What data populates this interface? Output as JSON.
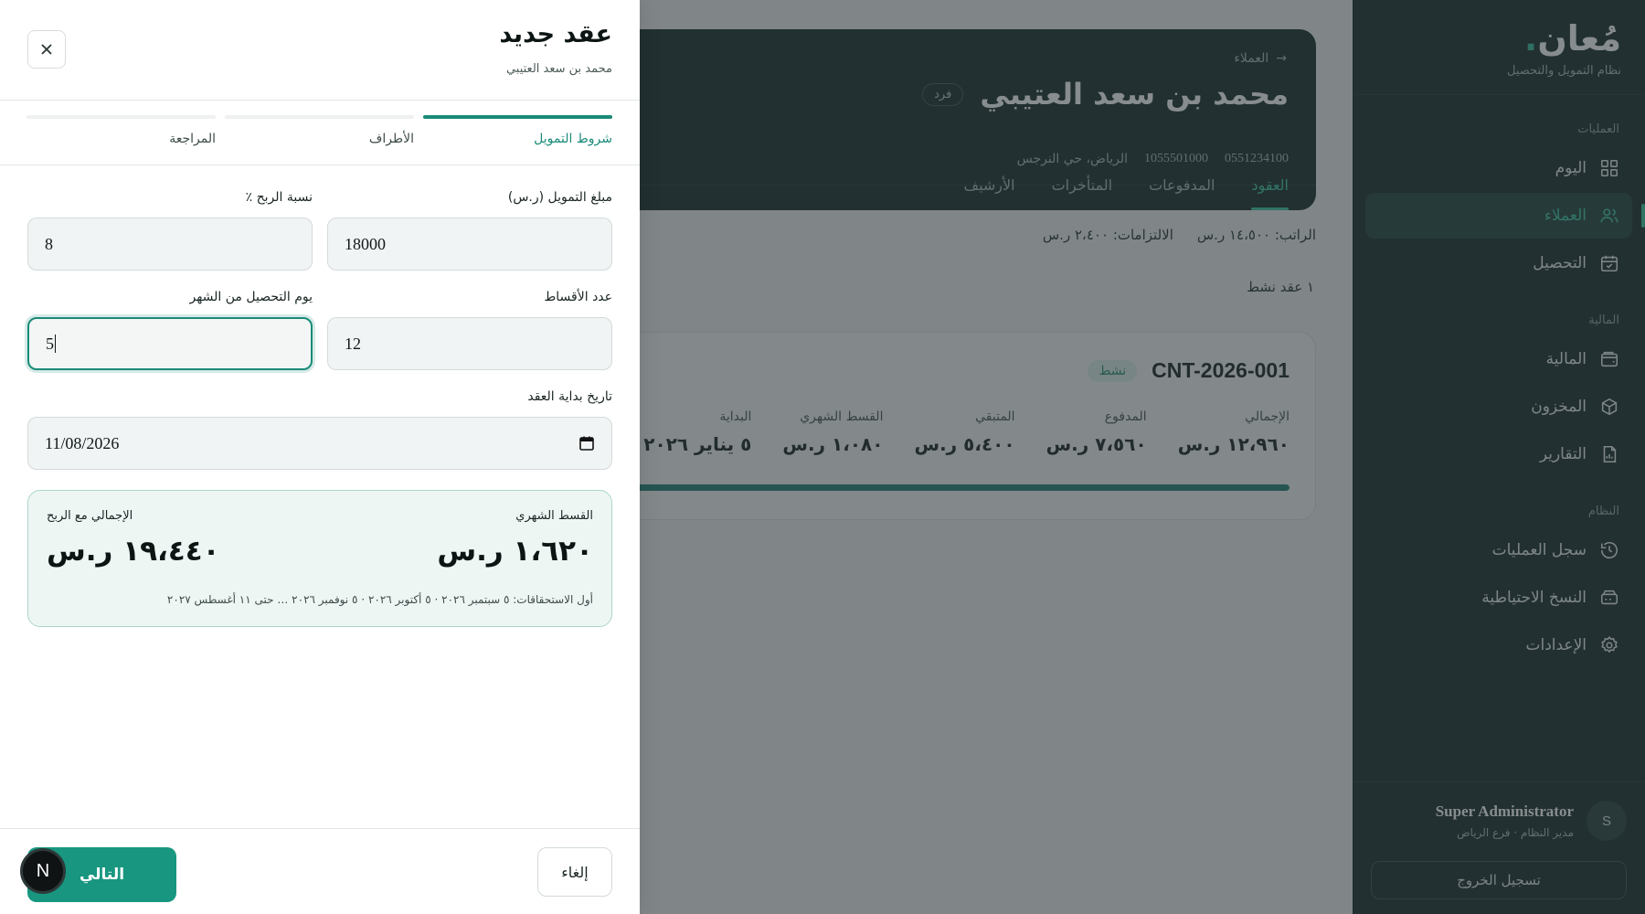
{
  "sidebar": {
    "brand": "مُعان",
    "brand_dot": ".",
    "brand_sub": "نظام التمويل والتحصيل",
    "sections": {
      "operations": "العمليات",
      "finance": "المالية",
      "system": "النظام"
    },
    "items": [
      {
        "label": "اليوم",
        "icon": "dashboard-icon"
      },
      {
        "label": "العملاء",
        "icon": "users-icon",
        "active": true
      },
      {
        "label": "التحصيل",
        "icon": "calendar-check-icon"
      },
      {
        "label": "المالية",
        "icon": "wallet-icon"
      },
      {
        "label": "المخزون",
        "icon": "box-icon"
      },
      {
        "label": "التقارير",
        "icon": "report-icon"
      },
      {
        "label": "سجل العمليات",
        "icon": "history-icon"
      },
      {
        "label": "النسخ الاحتياطية",
        "icon": "backup-icon"
      },
      {
        "label": "الإعدادات",
        "icon": "gear-icon"
      }
    ],
    "user": {
      "initial": "S",
      "name": "Super Administrator",
      "role": "مدير النظام · فرع الرياض"
    },
    "logout": "تسجيل الخروج"
  },
  "client": {
    "breadcrumb": "العملاء",
    "name": "محمد بن سعد العتيبي",
    "type": "فرد",
    "phone": "0551234100",
    "national_id": "1055501000",
    "address": "الرياض، حي النرجس",
    "tabs": [
      "العقود",
      "المدفوعات",
      "المتأخرات",
      "الأرشيف"
    ]
  },
  "financial": {
    "salary": "الراتب: ١٤،٥٠٠ ر.س",
    "obligations": "الالتزامات: ٢،٤٠٠ ر.س"
  },
  "active_contracts": "١ عقد نشط",
  "contract": {
    "number": "CNT-2026-001",
    "status": "نشط",
    "stats": [
      {
        "label": "الإجمالي",
        "value": "١٢،٩٦٠ ر.س"
      },
      {
        "label": "المدفوع",
        "value": "٧،٥٦٠ ر.س"
      },
      {
        "label": "المتبقي",
        "value": "٥،٤٠٠ ر.س"
      },
      {
        "label": "القسط الشهري",
        "value": "١،٠٨٠ ر.س"
      },
      {
        "label": "البداية",
        "value": "٥ يناير ٢٠٢٦"
      }
    ],
    "progress": 1.0,
    "progress_color": "#177c6e"
  },
  "drawer": {
    "title": "عقد جديد",
    "subtitle": "محمد بن سعد العتيبي",
    "steps": [
      {
        "label": "شروط التمويل",
        "active": true
      },
      {
        "label": "الأطراف",
        "active": false
      },
      {
        "label": "المراجعة",
        "active": false
      }
    ],
    "fields": {
      "amount": {
        "label": "مبلغ التمويل (ر.س)",
        "value": "18000"
      },
      "profit": {
        "label": "نسبة الربح ٪",
        "value": "8"
      },
      "installments": {
        "label": "عدد الأقساط",
        "value": "12"
      },
      "collection_day": {
        "label": "يوم التحصيل من الشهر",
        "value": "5"
      },
      "start_date": {
        "label": "تاريخ بداية العقد",
        "value": "11/08/2026"
      }
    },
    "summary": {
      "monthly_label": "القسط الشهري",
      "monthly_value": "١،٦٢٠ ر.س",
      "total_label": "الإجمالي مع الربح",
      "total_value": "١٩،٤٤٠ ر.س",
      "note": "أول الاستحقاقات: ٥ سبتمبر ٢٠٢٦ · ٥ أكتوبر ٢٠٢٦ · ٥ نوفمبر ٢٠٢٦ … حتى ١١ أغسطس ٢٠٢٧"
    },
    "cancel": "إلغاء",
    "next": "التالي"
  },
  "dev_badge": "N",
  "colors": {
    "accent": "#1a8b78",
    "sidebar_bg": "#0f2523",
    "active_nav": "#35c4a1"
  }
}
